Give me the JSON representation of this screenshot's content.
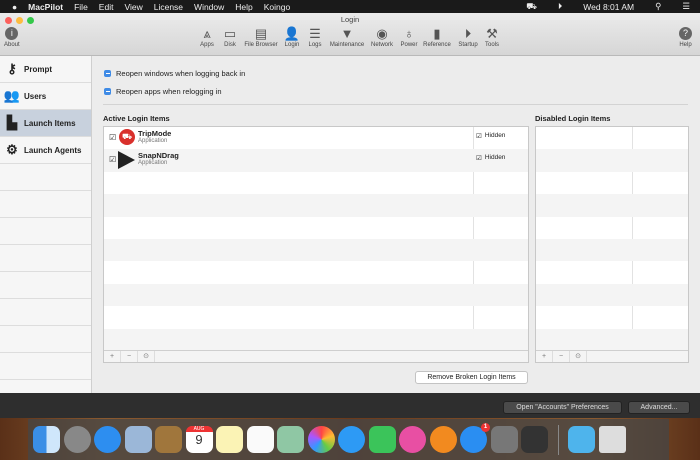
{
  "menubar": {
    "app": "MacPilot",
    "items": [
      "File",
      "Edit",
      "View",
      "License",
      "Window",
      "Help",
      "Koingo"
    ],
    "clock": "Wed 8:01 AM"
  },
  "window": {
    "title": "Login"
  },
  "toolbar": {
    "about": "About",
    "help": "Help",
    "items": [
      {
        "label": "Apps",
        "icon": "apps-icon",
        "glyph": "⩓"
      },
      {
        "label": "Disk",
        "icon": "disk-icon",
        "glyph": "▭"
      },
      {
        "label": "File Browser",
        "icon": "file-browser-icon",
        "glyph": "▤"
      },
      {
        "label": "Login",
        "icon": "login-icon",
        "glyph": "👤"
      },
      {
        "label": "Logs",
        "icon": "logs-icon",
        "glyph": "☰"
      },
      {
        "label": "Maintenance",
        "icon": "maintenance-icon",
        "glyph": "▼"
      },
      {
        "label": "Network",
        "icon": "network-icon",
        "glyph": "◉"
      },
      {
        "label": "Power",
        "icon": "power-icon",
        "glyph": "♁"
      },
      {
        "label": "Reference",
        "icon": "reference-icon",
        "glyph": "▮"
      },
      {
        "label": "Startup",
        "icon": "startup-icon",
        "glyph": "⏵"
      },
      {
        "label": "Tools",
        "icon": "tools-icon",
        "glyph": "⚒"
      }
    ]
  },
  "sidebar": {
    "items": [
      {
        "label": "Prompt",
        "glyph": "⚷"
      },
      {
        "label": "Users",
        "glyph": "👥"
      },
      {
        "label": "Launch Items",
        "glyph": "▙"
      },
      {
        "label": "Launch Agents",
        "glyph": "⚙"
      }
    ],
    "selected": "Launch Items"
  },
  "options": {
    "reopen_windows": "Reopen windows when logging back in",
    "reopen_apps": "Reopen apps when relogging in"
  },
  "active": {
    "title": "Active Login Items",
    "items": [
      {
        "name": "TripMode",
        "type": "Application",
        "enabled": true,
        "hidden_label": "Hidden",
        "hidden": true
      },
      {
        "name": "SnapNDrag",
        "type": "Application",
        "enabled": true,
        "hidden_label": "Hidden",
        "hidden": true
      }
    ]
  },
  "disabled": {
    "title": "Disabled Login Items"
  },
  "footer": {
    "add": "+",
    "remove": "−",
    "gear": "⊙"
  },
  "buttons": {
    "remove_broken": "Remove Broken Login Items",
    "open_accounts": "Open \"Accounts\" Preferences",
    "advanced": "Advanced..."
  },
  "dock": {
    "appstore_badge": "1",
    "calendar_month": "AUG",
    "calendar_day": "9"
  }
}
